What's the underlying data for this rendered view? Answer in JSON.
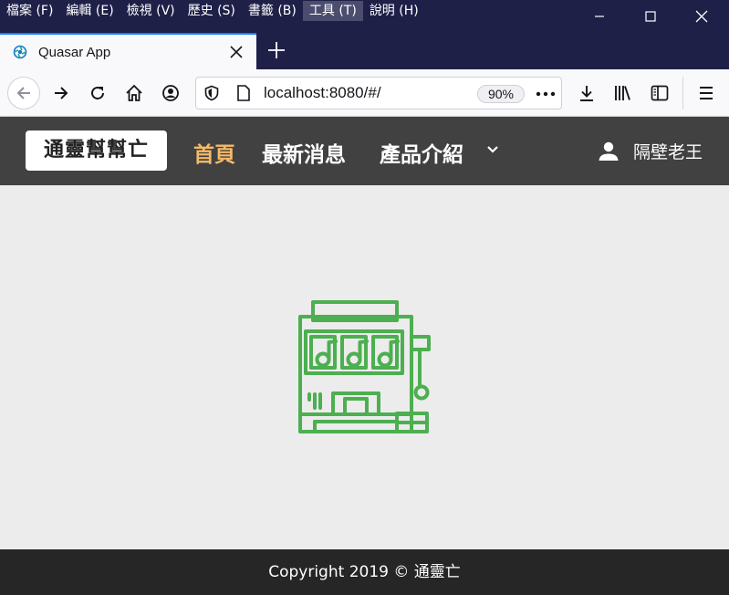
{
  "menu": [
    {
      "label": "檔案 (F)"
    },
    {
      "label": "編輯 (E)"
    },
    {
      "label": "檢視 (V)"
    },
    {
      "label": "歷史 (S)"
    },
    {
      "label": "書籤 (B)"
    },
    {
      "label": "工具 (T)"
    },
    {
      "label": "說明 (H)"
    }
  ],
  "window_controls": {
    "minimize": "minimize-icon",
    "maximize": "maximize-icon",
    "close": "close-icon"
  },
  "tab": {
    "title": "Quasar App",
    "favicon": "quasar-icon",
    "close": "close-icon"
  },
  "navigation": {
    "url": "localhost:8080/#/",
    "zoom": "90%",
    "icons": [
      "back-icon",
      "forward-icon",
      "reload-icon",
      "home-icon",
      "account-icon",
      "shield-icon",
      "page-icon",
      "more-icon",
      "download-icon",
      "library-icon",
      "sidebar-icon",
      "menu-icon"
    ]
  },
  "app": {
    "brand": "通靈幫幫亡",
    "nav": [
      {
        "label": "首頁"
      },
      {
        "label": "最新消息"
      },
      {
        "label": "產品介紹"
      }
    ],
    "user": "隔壁老王",
    "accent_color": "#f5b969",
    "icon_color": "#4caf50"
  },
  "footer": {
    "text": "Copyright 2019 © 通靈亡"
  }
}
